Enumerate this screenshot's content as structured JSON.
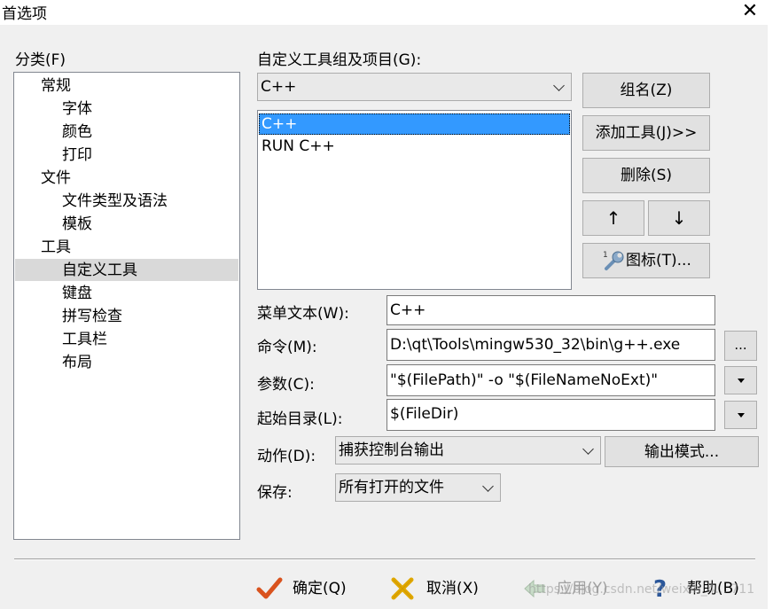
{
  "window": {
    "title": "首选项",
    "close_glyph": "✕"
  },
  "category": {
    "label": "分类(F)",
    "items": [
      {
        "label": "常规",
        "level": 0
      },
      {
        "label": "字体",
        "level": 1
      },
      {
        "label": "颜色",
        "level": 1
      },
      {
        "label": "打印",
        "level": 1
      },
      {
        "label": "文件",
        "level": 0
      },
      {
        "label": "文件类型及语法",
        "level": 1
      },
      {
        "label": "模板",
        "level": 1
      },
      {
        "label": "工具",
        "level": 0
      },
      {
        "label": "自定义工具",
        "level": 1,
        "selected": true
      },
      {
        "label": "键盘",
        "level": 1
      },
      {
        "label": "拼写检查",
        "level": 1
      },
      {
        "label": "工具栏",
        "level": 1
      },
      {
        "label": "布局",
        "level": 1
      }
    ]
  },
  "tools": {
    "group_label": "自定义工具组及项目(G):",
    "group_value": "C++",
    "items": [
      "C++",
      "RUN C++"
    ],
    "selected_index": 0
  },
  "buttons": {
    "group_name": "组名(Z)",
    "add_tool": "添加工具(J)>>",
    "delete": "删除(S)",
    "up": "↑",
    "down": "↓",
    "icon": "图标(T)...",
    "output_mode": "输出模式...",
    "browse": "..."
  },
  "fields": {
    "menu_text": {
      "label": "菜单文本(W):",
      "value": "C++"
    },
    "command": {
      "label": "命令(M):",
      "value": "D:\\qt\\Tools\\mingw530_32\\bin\\g++.exe"
    },
    "args": {
      "label": "参数(C):",
      "value": "\"$(FilePath)\" -o \"$(FileNameNoExt)\""
    },
    "start_dir": {
      "label": "起始目录(L):",
      "value": "$(FileDir)"
    },
    "action": {
      "label": "动作(D):",
      "value": "捕获控制台输出"
    },
    "save": {
      "label": "保存:",
      "value": "所有打开的文件"
    }
  },
  "footer": {
    "ok": "确定(Q)",
    "cancel": "取消(X)",
    "apply": "应用(Y)",
    "help": "帮助(B)",
    "watermark": "https://blog.csdn.net/weixin_4... 711"
  },
  "colors": {
    "selection": "#3399ff",
    "tree_selection": "#d9d9d9",
    "ok_check": "#d9531e",
    "cancel_x": "#e0a800",
    "help_q": "#2b579a"
  }
}
